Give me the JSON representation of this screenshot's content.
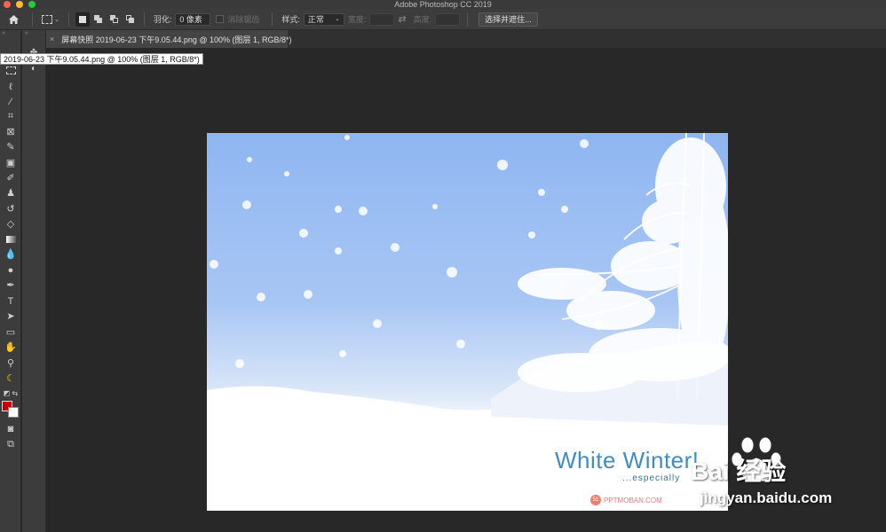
{
  "app": {
    "title": "Adobe Photoshop CC 2019"
  },
  "options_bar": {
    "feather_label": "羽化:",
    "feather_value": "0 像素",
    "antialias_label": "消除锯齿",
    "style_label": "样式:",
    "style_value": "正常",
    "width_label": "宽度:",
    "height_label": "高度:",
    "select_mask_button": "选择并遮住..."
  },
  "document": {
    "tab_title": "屏幕快照 2019-06-23 下午9.05.44.png @ 100% (图层 1, RGB/8*)",
    "close_glyph": "×",
    "tooltip": "2019-06-23 下午9.05.44.png @ 100% (图层 1, RGB/8*)"
  },
  "canvas_image": {
    "headline": "White Winter!",
    "subline": "...especially",
    "brand_badge": "51",
    "brand": "PPTMOBAN.COM"
  },
  "watermark": {
    "main": "Bai 经验",
    "url": "jingyan.baidu.com"
  },
  "colors": {
    "foreground": "#c60000",
    "background": "#ffffff",
    "accent_text": "#3e8ec4"
  },
  "toolbar_icons": [
    "move-icon",
    "marquee-icon",
    "lasso-icon",
    "magic-wand-icon",
    "crop-icon",
    "frame-icon",
    "eyedropper-icon",
    "spot-healing-icon",
    "brush-icon",
    "clone-stamp-icon",
    "history-brush-icon",
    "eraser-icon",
    "gradient-icon",
    "blur-icon",
    "dodge-icon",
    "pen-icon",
    "type-icon",
    "path-select-icon",
    "rectangle-icon",
    "hand-icon",
    "zoom-icon",
    "edit-toolbar-icon"
  ]
}
